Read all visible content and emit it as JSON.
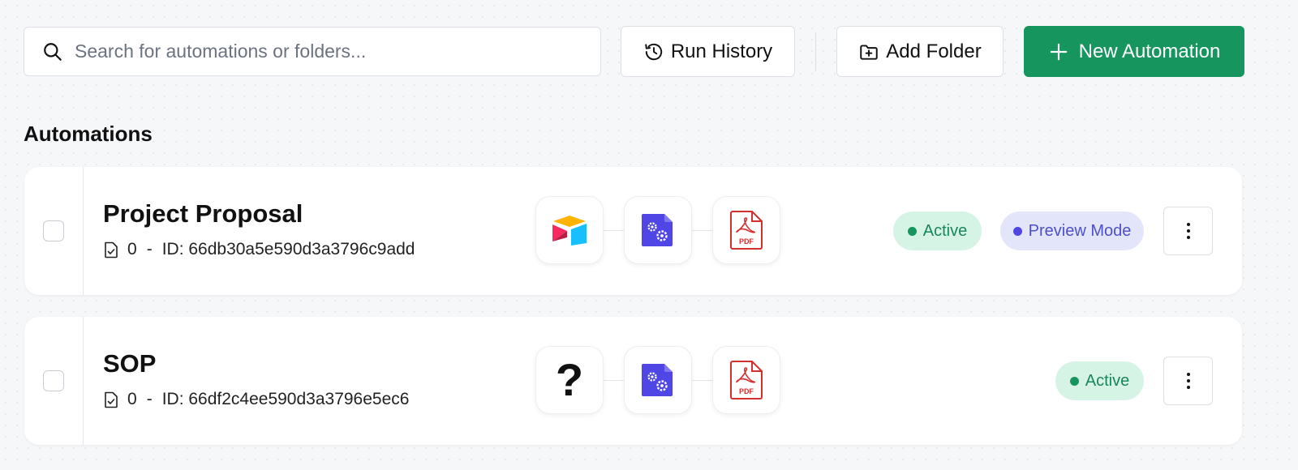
{
  "search": {
    "placeholder": "Search for automations or folders...",
    "value": "",
    "icon": "search-icon"
  },
  "toolbar": {
    "run_history_label": "Run History",
    "add_folder_label": "Add Folder",
    "new_automation_label": "New Automation"
  },
  "colors": {
    "primary_green": "#16955f",
    "active_badge_bg": "#d6f4e6",
    "preview_badge_bg": "#e3e6fb",
    "preview_badge_text": "#4c50c9",
    "pdf_red": "#d32f2f",
    "process_purple": "#4f46e5"
  },
  "section": {
    "title": "Automations"
  },
  "automations": [
    {
      "title": "Project Proposal",
      "run_count": "0",
      "separator": "-",
      "id_text": "ID: 66db30a5e590d3a3796c9add",
      "steps": [
        "airtable-icon",
        "process-settings-icon",
        "pdf-icon"
      ],
      "badges": [
        "Active",
        "Preview Mode"
      ]
    },
    {
      "title": "SOP",
      "run_count": "0",
      "separator": "-",
      "id_text": "ID: 66df2c4ee590d3a3796e5ec6",
      "steps": [
        "question-mark-icon",
        "process-settings-icon",
        "pdf-icon"
      ],
      "badges": [
        "Active"
      ]
    }
  ],
  "icons": {
    "pdf_label": "PDF",
    "unknown_source": "?"
  }
}
